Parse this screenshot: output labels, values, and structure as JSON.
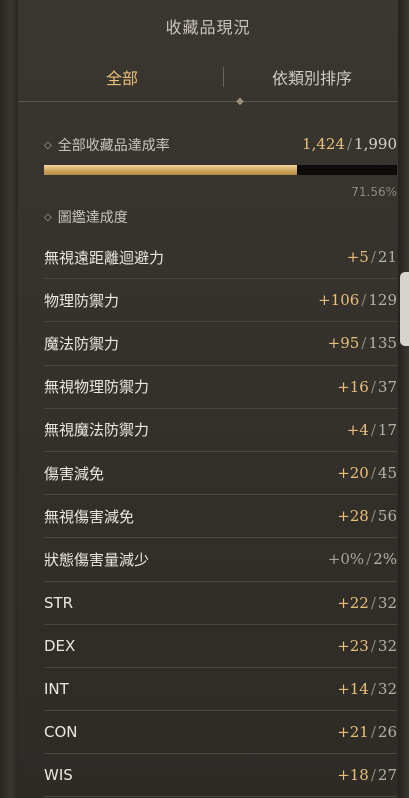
{
  "header": {
    "title": "收藏品現況"
  },
  "tabs": [
    {
      "label": "全部",
      "active": true
    },
    {
      "label": "依類別排序",
      "active": false
    }
  ],
  "summary": {
    "label": "全部收藏品達成率",
    "collected": "1,424",
    "total": "1,990",
    "progress_fraction": 0.7156,
    "percent_text": "71.56%"
  },
  "codex": {
    "label": "圖鑑達成度"
  },
  "stats": [
    {
      "name": "無視遠距離迴避力",
      "bonus": "+5",
      "max": "21"
    },
    {
      "name": "物理防禦力",
      "bonus": "+106",
      "max": "129"
    },
    {
      "name": "魔法防禦力",
      "bonus": "+95",
      "max": "135"
    },
    {
      "name": "無視物理防禦力",
      "bonus": "+16",
      "max": "37"
    },
    {
      "name": "無視魔法防禦力",
      "bonus": "+4",
      "max": "17"
    },
    {
      "name": "傷害減免",
      "bonus": "+20",
      "max": "45"
    },
    {
      "name": "無視傷害減免",
      "bonus": "+28",
      "max": "56"
    },
    {
      "name": "狀態傷害量減少",
      "bonus": "+0%",
      "max": "2%"
    },
    {
      "name": "STR",
      "bonus": "+22",
      "max": "32"
    },
    {
      "name": "DEX",
      "bonus": "+23",
      "max": "32"
    },
    {
      "name": "INT",
      "bonus": "+14",
      "max": "32"
    },
    {
      "name": "CON",
      "bonus": "+21",
      "max": "26"
    },
    {
      "name": "WIS",
      "bonus": "+18",
      "max": "27"
    }
  ],
  "colors": {
    "accent": "#e8c07a",
    "progress": "#cfa55a"
  },
  "icons": {
    "section_marker": "diamond-icon"
  }
}
